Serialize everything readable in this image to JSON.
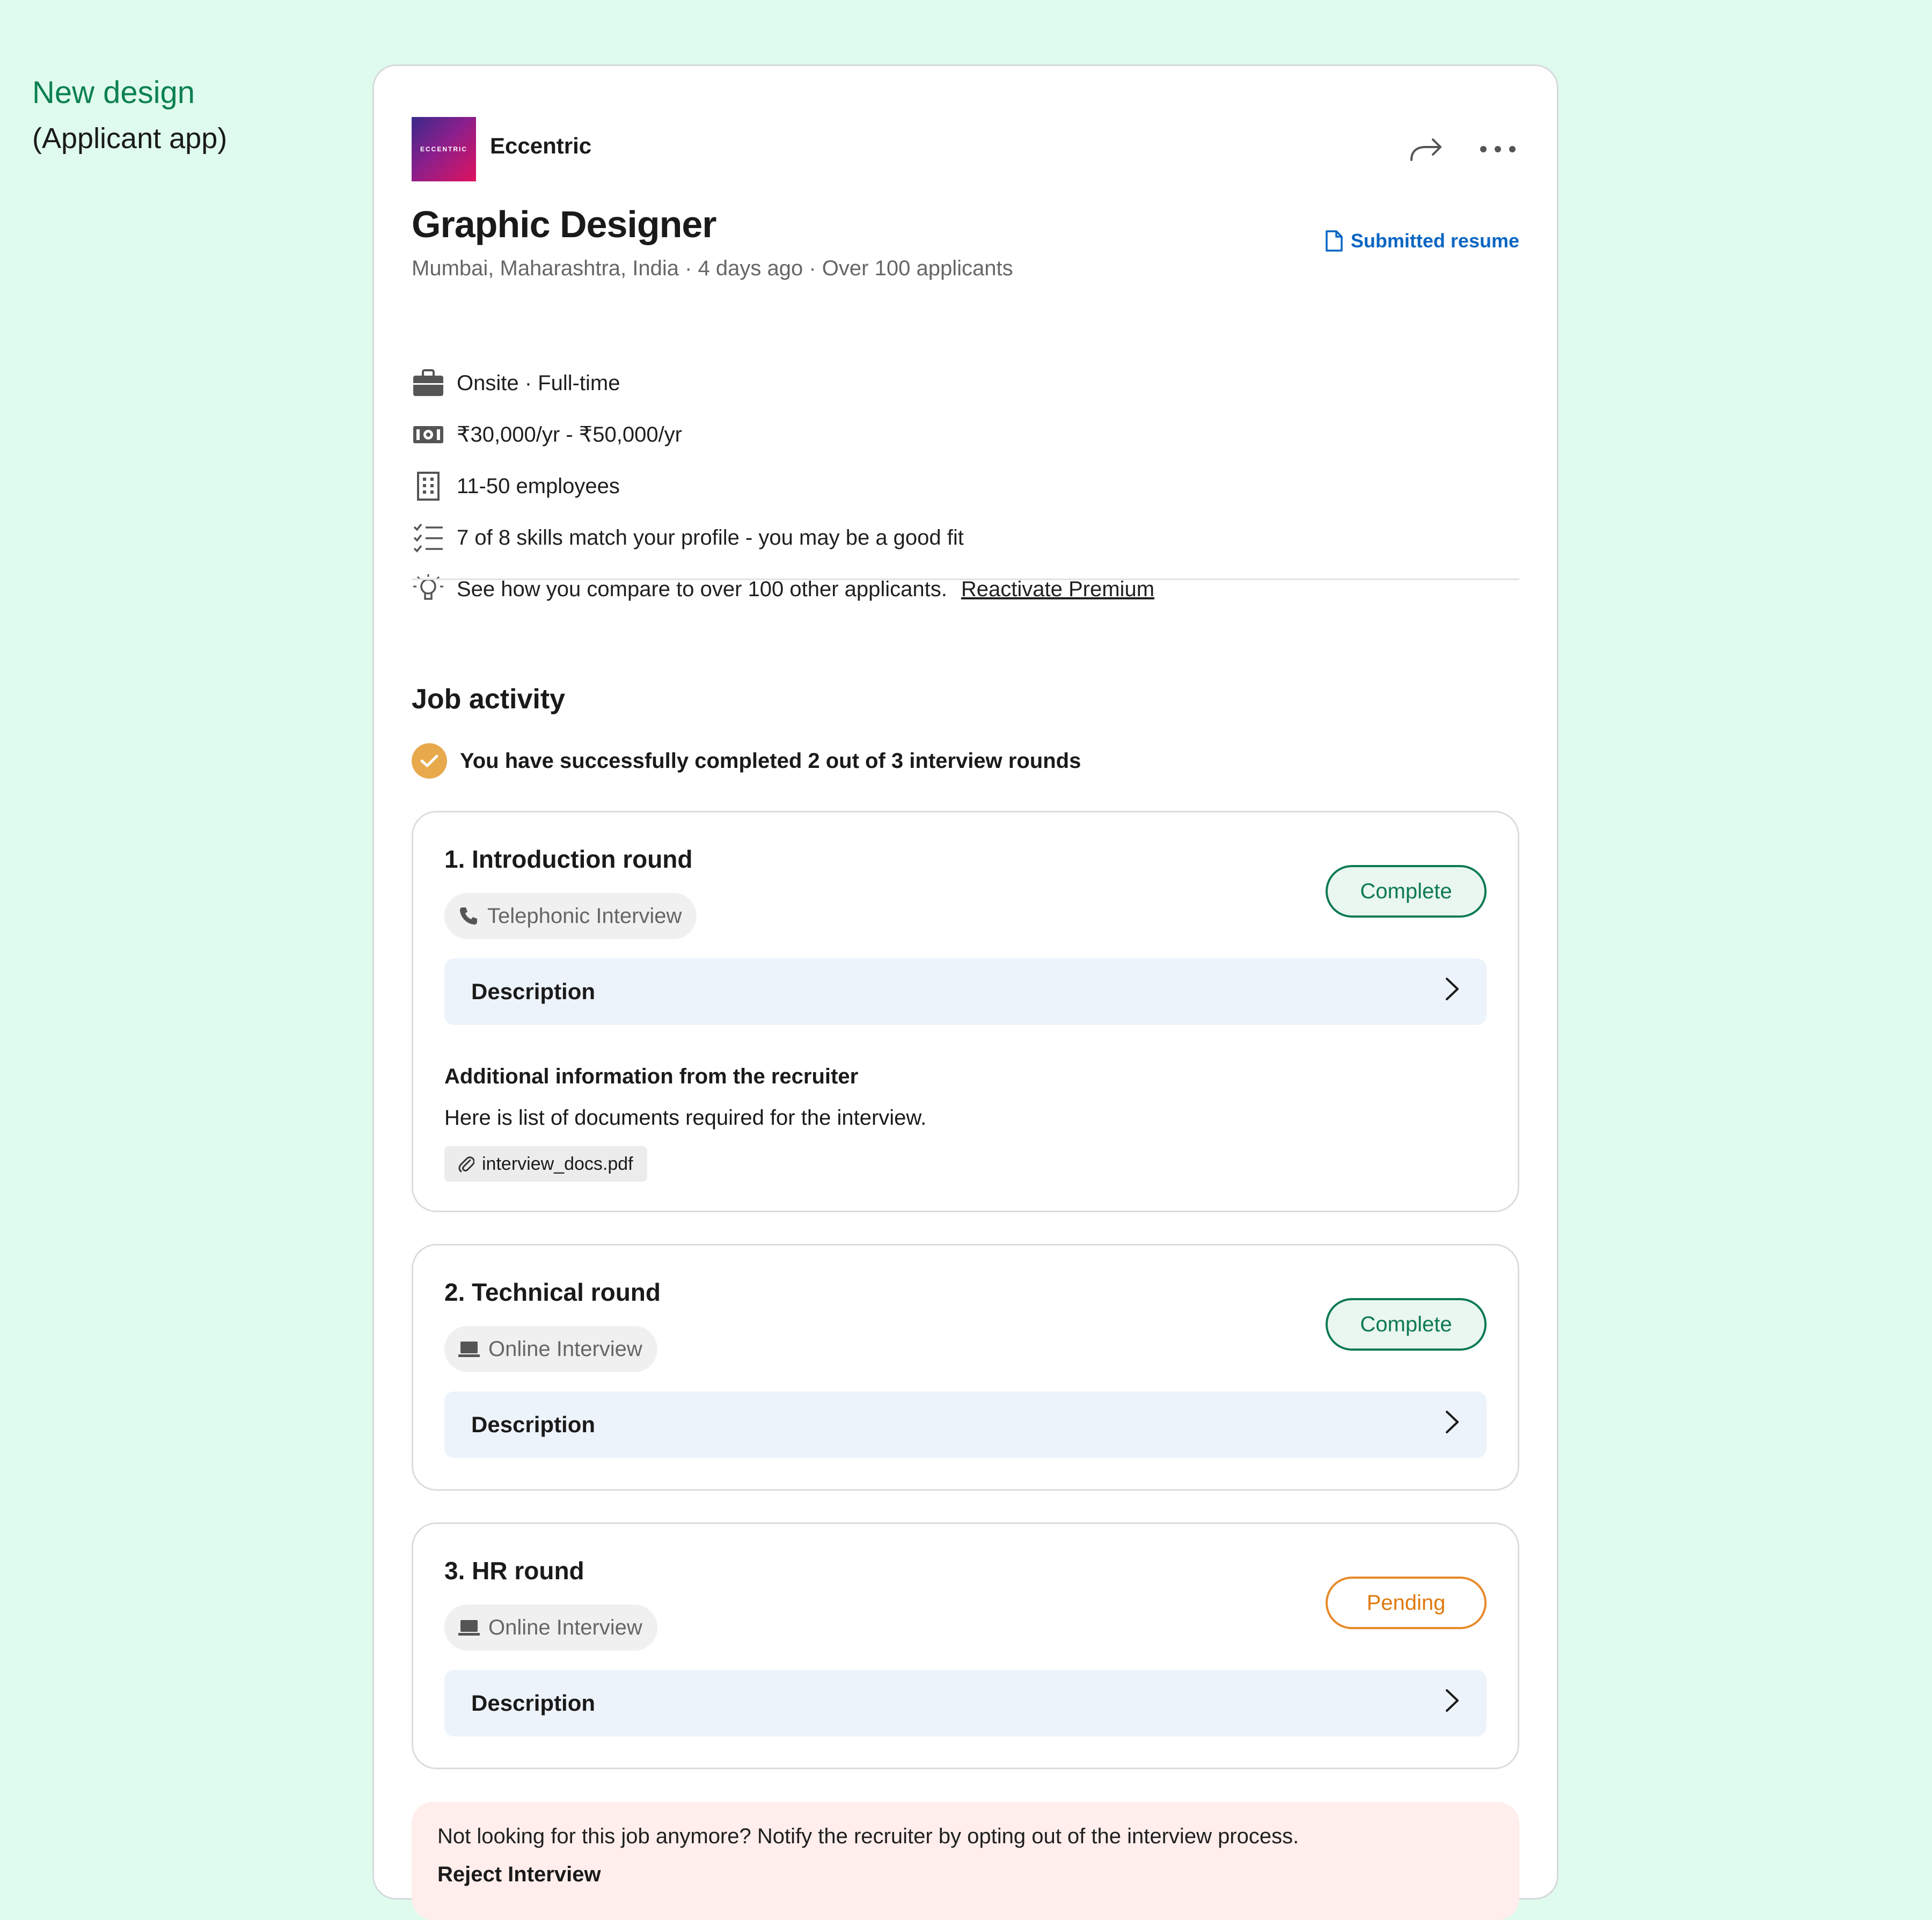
{
  "side_note": {
    "line1": "New design",
    "line2": "(Applicant app)"
  },
  "company": {
    "name": "Eccentric",
    "logo_text": "ECCENTRIC"
  },
  "icons": {
    "share": "share-arrow-icon",
    "more": "more-dots-icon"
  },
  "job": {
    "title": "Graphic Designer",
    "meta": "Mumbai, Maharashtra, India · 4 days ago · Over 100 applicants",
    "submitted_resume": "Submitted resume",
    "features": {
      "workplace": "Onsite · Full-time",
      "salary": "₹30,000/yr - ₹50,000/yr",
      "size": "11-50 employees",
      "skills": "7 of 8 skills match your profile - you may be a good fit",
      "compare": "See how you compare to over 100 other applicants.",
      "premium_link": "Reactivate Premium"
    }
  },
  "activity": {
    "title": "Job activity",
    "progress": "You have successfully completed 2 out of 3 interview rounds"
  },
  "rounds": [
    {
      "title": "1. Introduction round",
      "type": "Telephonic Interview",
      "status": "Complete",
      "description": "Description",
      "additional_title": "Additional information from the recruiter",
      "additional_text": "Here is list of documents required for the interview.",
      "attachment": "interview_docs.pdf"
    },
    {
      "title": "2. Technical round",
      "type": "Online Interview",
      "status": "Complete",
      "description": "Description"
    },
    {
      "title": "3. HR round",
      "type": "Online Interview",
      "status": "Pending",
      "description": "Description"
    }
  ],
  "optout": {
    "text": "Not looking for this job anymore? Notify the recruiter by opting out of the interview process.",
    "action": "Reject Interview"
  },
  "colors": {
    "background": "#dffbee",
    "accent_green": "#0c7a52",
    "pending_orange": "#e07a10",
    "link_blue": "#0a66c2",
    "check_gold": "#e8a94d",
    "optout_bg": "#ffeeeb"
  }
}
